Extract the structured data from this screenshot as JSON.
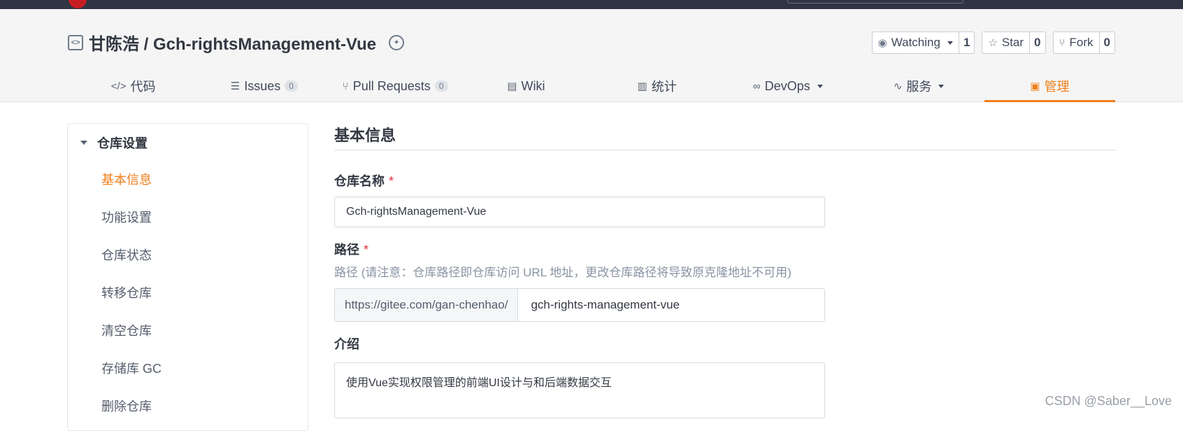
{
  "repo": {
    "title": "甘陈浩 / Gch-rightsManagement-Vue",
    "repo_icon": "repo-code-icon",
    "badge_icon": "award-badge-icon"
  },
  "actions": {
    "watch": {
      "label": "Watching",
      "count": "1",
      "icon": "eye-icon"
    },
    "star": {
      "label": "Star",
      "count": "0",
      "icon": "star-icon"
    },
    "fork": {
      "label": "Fork",
      "count": "0",
      "icon": "fork-icon"
    }
  },
  "tabs": [
    {
      "label": "代码",
      "icon": "code-icon"
    },
    {
      "label": "Issues",
      "count": "0",
      "icon": "issues-icon"
    },
    {
      "label": "Pull Requests",
      "count": "0",
      "icon": "pull-request-icon"
    },
    {
      "label": "Wiki",
      "icon": "book-icon"
    },
    {
      "label": "统计",
      "icon": "bar-chart-icon"
    },
    {
      "label": "DevOps",
      "icon": "infinity-icon"
    },
    {
      "label": "服务",
      "icon": "pulse-icon"
    },
    {
      "label": "管理",
      "icon": "manage-icon",
      "active": true
    }
  ],
  "sidebar": {
    "group_label": "仓库设置",
    "items": [
      {
        "label": "基本信息",
        "active": true
      },
      {
        "label": "功能设置"
      },
      {
        "label": "仓库状态"
      },
      {
        "label": "转移仓库"
      },
      {
        "label": "清空仓库"
      },
      {
        "label": "存储库 GC"
      },
      {
        "label": "删除仓库"
      }
    ]
  },
  "form": {
    "section_title": "基本信息",
    "name": {
      "label": "仓库名称",
      "required": "*",
      "value": "Gch-rightsManagement-Vue"
    },
    "path": {
      "label": "路径",
      "required": "*",
      "hint": "路径 (请注意：仓库路径即仓库访问 URL 地址，更改仓库路径将导致原克隆地址不可用)",
      "prefix": "https://gitee.com/gan-chenhao/",
      "value": "gch-rights-management-vue"
    },
    "intro": {
      "label": "介绍",
      "value": "使用Vue实现权限管理的前端UI设计与和后端数据交互"
    }
  },
  "watermark": "CSDN @Saber__Love",
  "colors": {
    "accent": "#f07e1a",
    "topbar": "#2f3542",
    "required": "#e0303a"
  }
}
